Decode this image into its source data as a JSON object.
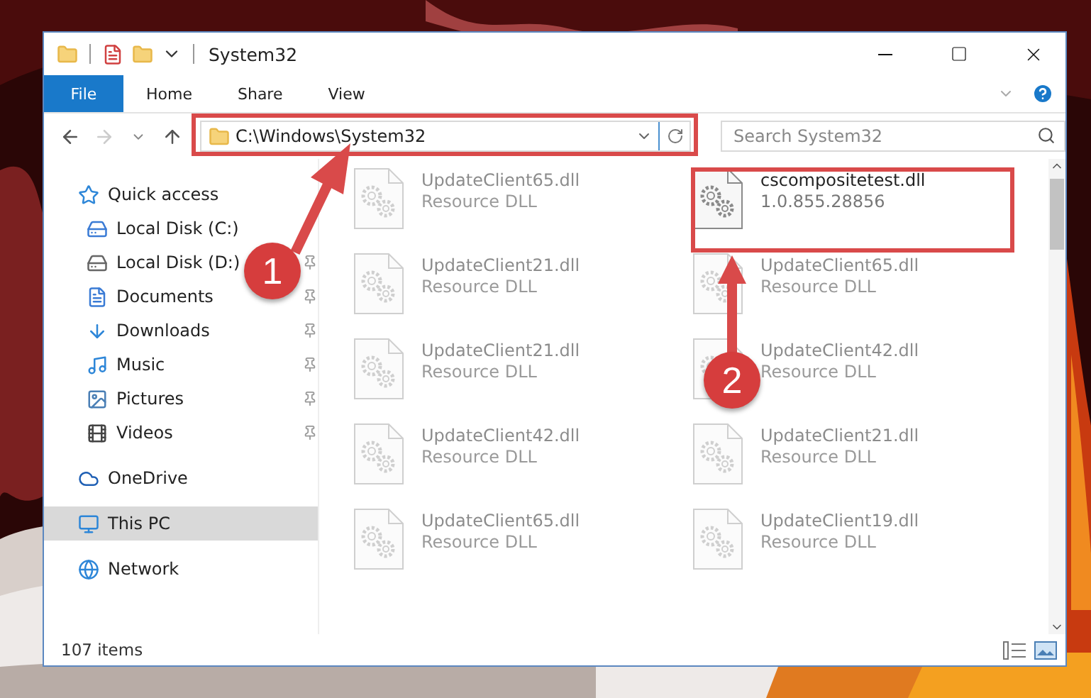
{
  "window": {
    "title": "System32"
  },
  "ribbon_tabs": [
    {
      "label": "File",
      "selected": true
    },
    {
      "label": "Home",
      "selected": false
    },
    {
      "label": "Share",
      "selected": false
    },
    {
      "label": "View",
      "selected": false
    }
  ],
  "address": {
    "value": "C:\\Windows\\System32"
  },
  "search": {
    "placeholder": "Search System32"
  },
  "sidebar": {
    "items": [
      {
        "label": "Quick access",
        "selected": false,
        "children": [
          {
            "label": "Local Disk (C:)",
            "selected": false,
            "pinned": false
          },
          {
            "label": "Local Disk (D:)",
            "selected": false,
            "pinned": true
          },
          {
            "label": "Documents",
            "selected": false,
            "pinned": true
          },
          {
            "label": "Downloads",
            "selected": false,
            "pinned": true
          },
          {
            "label": "Music",
            "selected": false,
            "pinned": true
          },
          {
            "label": "Pictures",
            "selected": false,
            "pinned": true
          },
          {
            "label": "Videos",
            "selected": false,
            "pinned": true
          }
        ]
      },
      {
        "label": "OneDrive",
        "selected": false
      },
      {
        "label": "This PC",
        "selected": true
      },
      {
        "label": "Network",
        "selected": false
      }
    ]
  },
  "files": [
    {
      "name": "UpdateClient65.dll",
      "detail": "Resource DLL",
      "blurred": true
    },
    {
      "name": "cscompositetest.dll",
      "detail": "1.0.855.28856",
      "blurred": false
    },
    {
      "name": "UpdateClient21.dll",
      "detail": "Resource DLL",
      "blurred": true
    },
    {
      "name": "UpdateClient65.dll",
      "detail": "Resource DLL",
      "blurred": true
    },
    {
      "name": "UpdateClient21.dll",
      "detail": "Resource DLL",
      "blurred": true
    },
    {
      "name": "UpdateClient42.dll",
      "detail": "Resource DLL",
      "blurred": true
    },
    {
      "name": "UpdateClient42.dll",
      "detail": "Resource DLL",
      "blurred": true
    },
    {
      "name": "UpdateClient21.dll",
      "detail": "Resource DLL",
      "blurred": true
    },
    {
      "name": "UpdateClient65.dll",
      "detail": "Resource DLL",
      "blurred": true
    },
    {
      "name": "UpdateClient19.dll",
      "detail": "Resource DLL",
      "blurred": true
    }
  ],
  "status_bar": {
    "count": "107 items"
  },
  "annotations": [
    {
      "number": "1"
    },
    {
      "number": "2"
    }
  ]
}
